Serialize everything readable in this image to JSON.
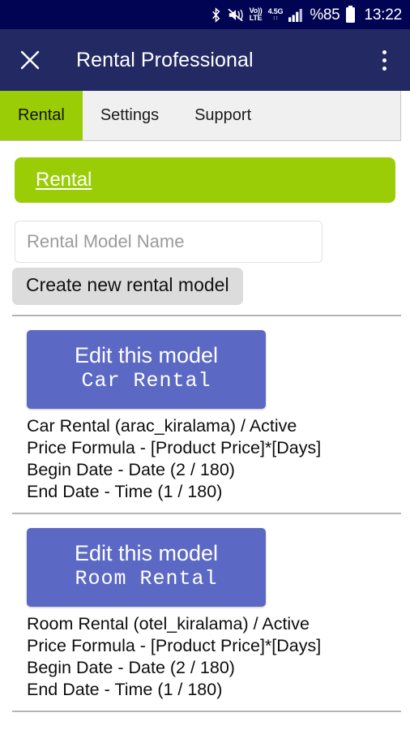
{
  "status_bar": {
    "icons": [
      "bluetooth-icon",
      "mute-icon",
      "volte-icon",
      "network-4-5g-icon",
      "signal-bars-icon"
    ],
    "volte_top": "Vo))",
    "volte_bottom": "LTE",
    "network_label": "4.5G",
    "battery_percent": "%85",
    "time": "13:22",
    "background_color": "#000452"
  },
  "app_bar": {
    "close_label": "close-icon",
    "title": "Rental Professional",
    "overflow_label": "more-options",
    "background_color": "#232a63"
  },
  "tabs": {
    "active_index": 0,
    "items": [
      {
        "label": "Rental"
      },
      {
        "label": "Settings"
      },
      {
        "label": "Support"
      }
    ],
    "active_color": "#9bcd06"
  },
  "banner": {
    "label": "Rental",
    "background_color": "#9bcd06"
  },
  "form": {
    "model_name_placeholder": "Rental Model Name",
    "model_name_value": "",
    "create_button_label": "Create new rental model"
  },
  "models": [
    {
      "edit_label": "Edit this model",
      "name_code": "Car Rental",
      "details": [
        "Car Rental (arac_kiralama) / Active",
        "Price Formula - [Product Price]*[Days]",
        "Begin Date - Date (2 / 180)",
        "End Date - Time (1 / 180)"
      ]
    },
    {
      "edit_label": "Edit this model",
      "name_code": "Room Rental",
      "details": [
        "Room Rental (otel_kiralama) / Active",
        "Price Formula - [Product Price]*[Days]",
        "Begin Date - Date (2 / 180)",
        "End Date - Time (1 / 180)"
      ]
    }
  ],
  "theme": {
    "button_blue": "#5b69c4",
    "divider_gray": "#b4b4b4"
  }
}
